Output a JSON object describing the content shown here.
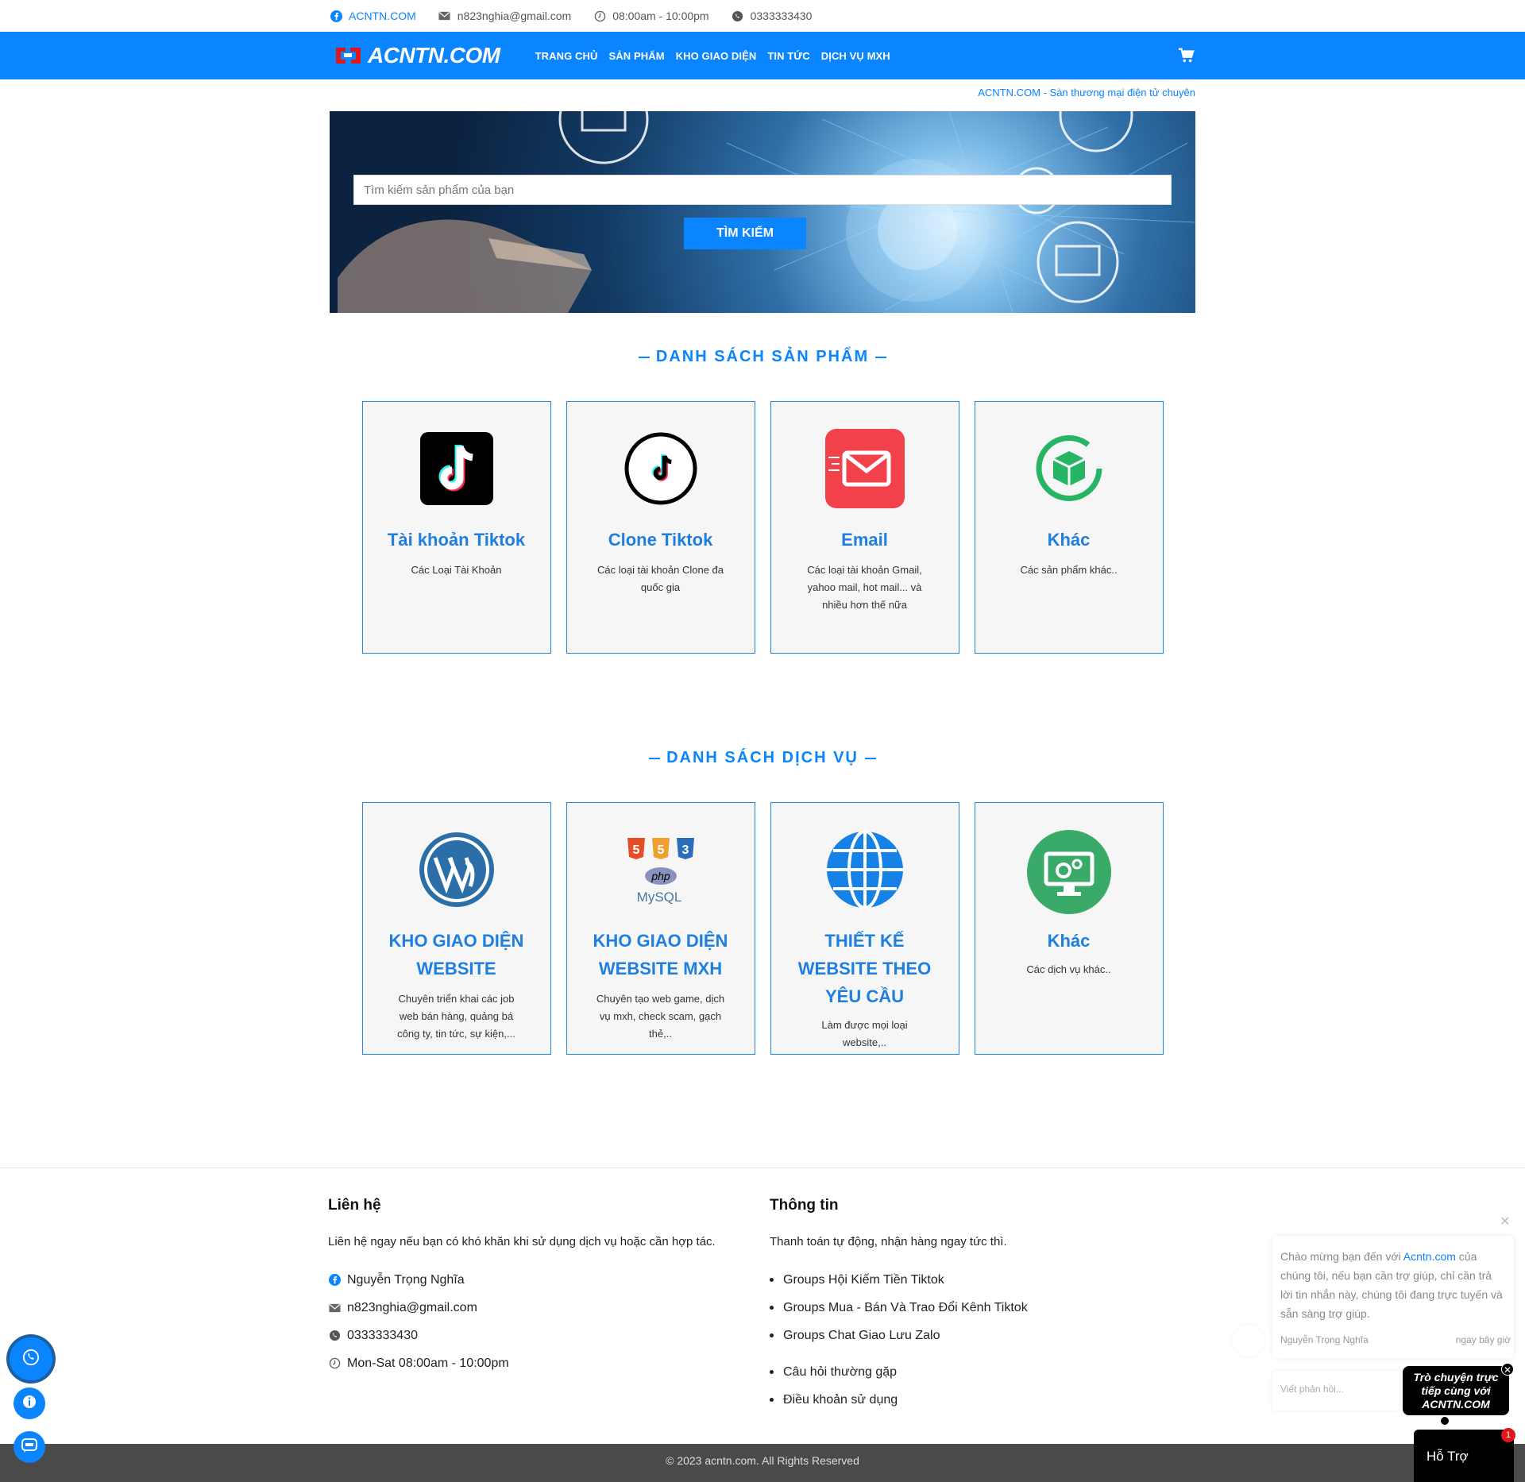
{
  "topbar": {
    "facebook": "ACNTN.COM",
    "email": "n823nghia@gmail.com",
    "hours": "08:00am - 10:00pm",
    "phone": "0333333430"
  },
  "nav": {
    "logo": "ACNTN.COM",
    "menu": [
      "TRANG CHỦ",
      "SẢN PHẨM",
      "KHO GIAO DIỆN",
      "TIN TỨC",
      "DỊCH VỤ MXH"
    ]
  },
  "marquee": "ACNTN.COM - Sàn thương mại điện tử chuyên",
  "search": {
    "placeholder": "Tìm kiếm sản phẩm của bạn",
    "button": "TÌM KIẾM"
  },
  "products": {
    "title": "DANH SÁCH SẢN PHẨM",
    "items": [
      {
        "name": "Tài khoản Tiktok",
        "desc": "Các Loại Tài Khoản",
        "icon": "tiktok-square-icon"
      },
      {
        "name": "Clone Tiktok",
        "desc": "Các loại tài khoản Clone đa quốc gia",
        "icon": "tiktok-circle-icon"
      },
      {
        "name": "Email",
        "desc": "Các loại tài khoản Gmail, yahoo mail, hot mail... và nhiều hơn thế nữa",
        "icon": "email-icon"
      },
      {
        "name": "Khác",
        "desc": "Các sản phẩm khác..",
        "icon": "box-icon"
      }
    ]
  },
  "services": {
    "title": "DANH SÁCH DỊCH VỤ",
    "items": [
      {
        "name": "KHO GIAO DIỆN WEBSITE",
        "desc": "Chuyên triển khai các job web bán hàng, quảng bá công ty, tin tức, sự kiện,...",
        "icon": "wordpress-icon"
      },
      {
        "name": "KHO GIAO DIỆN WEBSITE MXH",
        "desc": "Chuyên tạo web game, dịch vụ mxh, check scam, gạch thẻ,..",
        "icon": "web-stack-icon"
      },
      {
        "name": "THIẾT KẾ WEBSITE THEO YÊU CẦU",
        "desc": "Làm được mọi loại website,..",
        "icon": "globe-icon"
      },
      {
        "name": "Khác",
        "desc": "Các dịch vụ khác..",
        "icon": "monitor-gear-icon"
      }
    ]
  },
  "footer": {
    "contact": {
      "title": "Liên hệ",
      "lead": "Liên hệ ngay nếu bạn có khó khăn khi sử dụng dịch vụ hoặc cần hợp tác.",
      "name": "Nguyễn Trọng Nghĩa",
      "email": "n823nghia@gmail.com",
      "phone": "0333333430",
      "hours": "Mon-Sat 08:00am - 10:00pm"
    },
    "info": {
      "title": "Thông tin",
      "lead": "Thanh toán tự động, nhận hàng ngay tức thì.",
      "links": [
        "Groups Hội Kiếm Tiền Tiktok",
        "Groups Mua - Bán Và Trao Đổi Kênh Tiktok",
        "Groups Chat Giao Lưu Zalo"
      ],
      "links2": [
        "Câu hỏi thường gặp",
        "Điều khoản sử dụng"
      ]
    },
    "copyright": "© 2023 acntn.com. All Rights Reserved"
  },
  "chat": {
    "greeting_pre": "Chào mừng bạn đến với ",
    "greeting_link": "Acntn.com",
    "greeting_post": " của chúng tôi, nếu bạn cần trợ giúp, chỉ cần trả lời tin nhắn này, chúng tôi đang trực tuyến và sẵn sàng trợ giúp.",
    "agent": "Nguyễn Trọng Nghĩa",
    "time": "ngay bây giờ",
    "reply_placeholder": "Viết phản hồi...",
    "bubble": "Trò chuyện trực tiếp cùng với ACNTN.COM",
    "support": "Hỗ Trợ",
    "badge": "1"
  },
  "colors": {
    "brand": "#0a84ff",
    "footer_bar": "#4a4a4a"
  }
}
